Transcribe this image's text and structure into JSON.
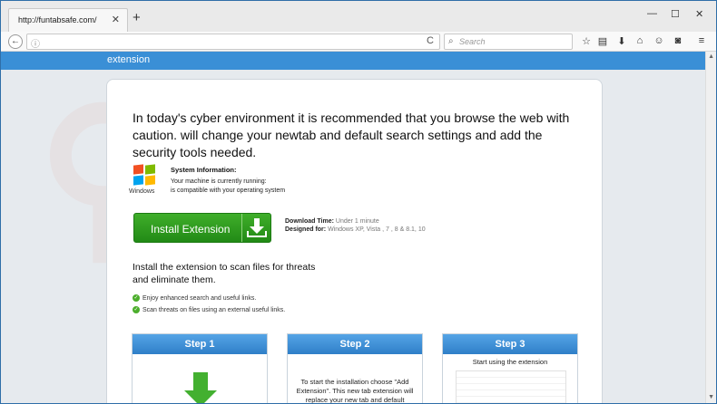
{
  "browser": {
    "tab_title": "http://funtabsafe.com/",
    "tab_close": "✕",
    "new_tab": "+",
    "window_minimize": "—",
    "window_restore": "☐",
    "window_close": "✕",
    "back": "←",
    "info": "ⓘ",
    "reload": "C",
    "search_placeholder": "Search",
    "search_glyph": "⌕"
  },
  "page": {
    "header_label": "extension",
    "headline": "In today's cyber environment it is recommended that you browse the web with caution. will change your newtab and default search settings and add the security tools needed.",
    "windows_caption": "Windows",
    "sysinfo": {
      "title": "System Information:",
      "line1": "Your machine is currently running:",
      "line2": "is compatible with your operating system"
    },
    "install_button": "Install Extension",
    "download_time_label": "Download Time:",
    "download_time_value": "Under 1 minute",
    "designed_for_label": "Designed for:",
    "designed_for_value": "Windows XP, Vista , 7 , 8 & 8.1, 10",
    "scan_text": "Install the extension to scan files for threats and eliminate them.",
    "checks": [
      "Enjoy enhanced search and useful links.",
      "Scan threats on files using an external useful links."
    ],
    "check_glyph": "✓",
    "steps": [
      {
        "title": "Step 1",
        "body": ""
      },
      {
        "title": "Step 2",
        "body": "To start the installation choose \"Add Extension\". This new tab extension will replace your new tab and default"
      },
      {
        "title": "Step 3",
        "body": "Start using the extension"
      }
    ]
  },
  "colors": {
    "accent_blue": "#3a8fd6",
    "install_green": "#2e9c1f",
    "windows_logo": [
      "#f25022",
      "#7fba00",
      "#00a4ef",
      "#ffb900"
    ]
  }
}
